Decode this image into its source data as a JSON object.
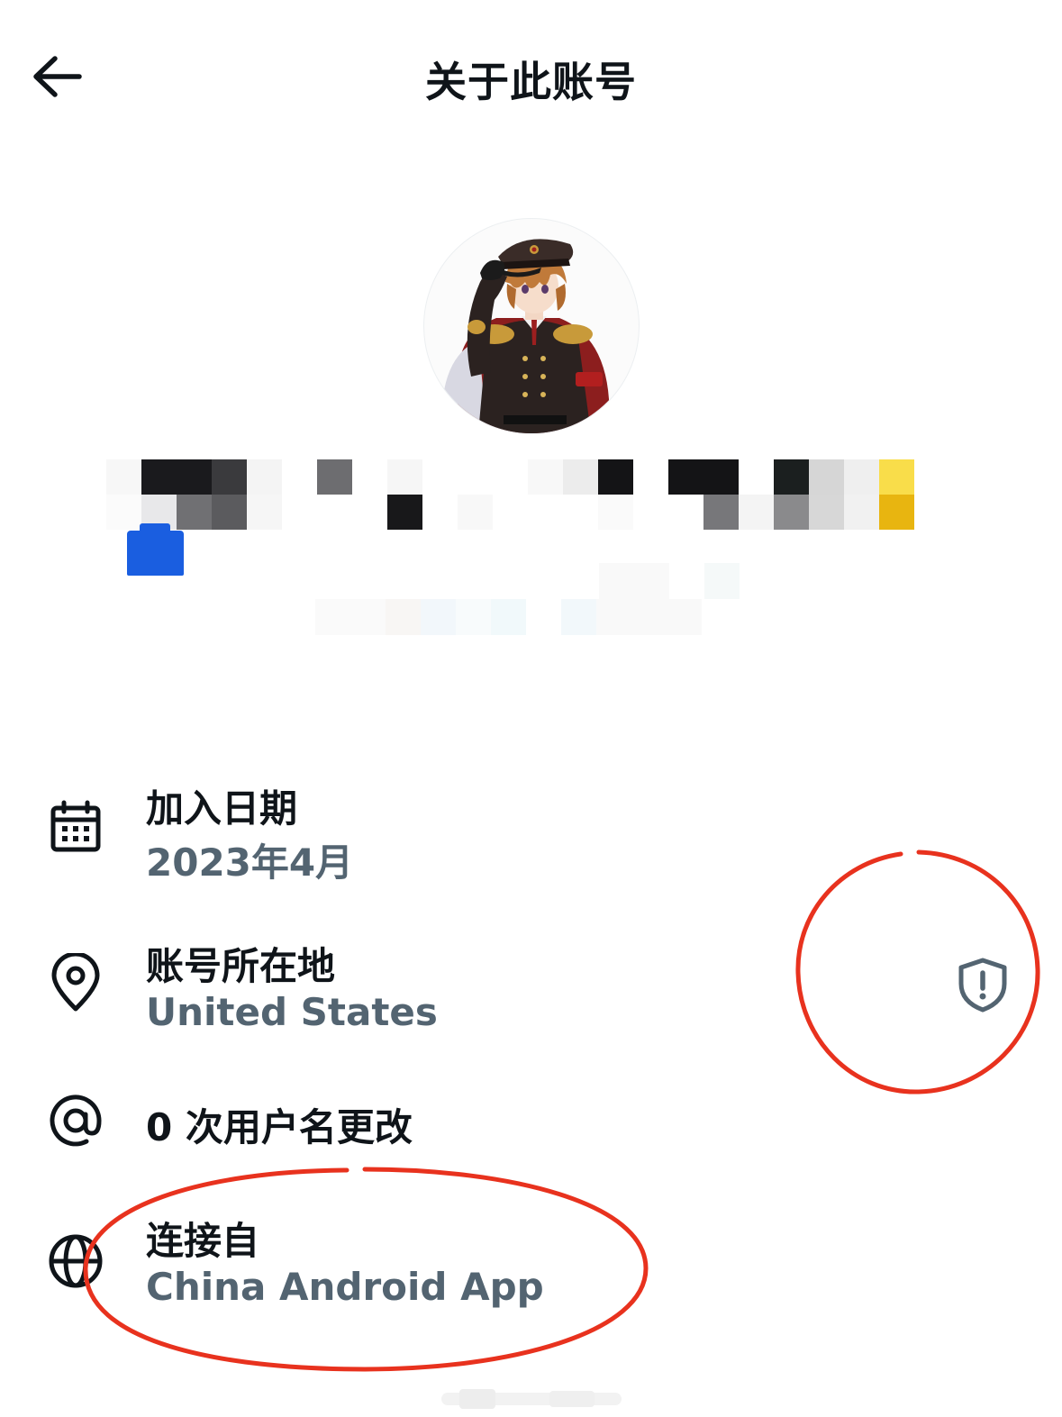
{
  "header": {
    "title": "关于此账号",
    "back_icon": "arrow-left-icon"
  },
  "profile": {
    "avatar": "anime-character-in-military-uniform",
    "name_redacted": true,
    "handle_redacted": true,
    "verified_badge_color": "#1a5ee0"
  },
  "details": {
    "joined": {
      "icon": "calendar-icon",
      "label": "加入日期",
      "value": "2023年4月"
    },
    "location": {
      "icon": "location-pin-icon",
      "label": "账号所在地",
      "value": "United States",
      "info_icon": "shield-alert-icon"
    },
    "username_changes": {
      "icon": "at-sign-icon",
      "label": "0 次用户名更改"
    },
    "connected_via": {
      "icon": "globe-icon",
      "label": "连接自",
      "value": "China Android App"
    }
  },
  "colors": {
    "text_primary": "#0f1419",
    "text_secondary": "#536471",
    "annotation_red": "#e8321e"
  }
}
